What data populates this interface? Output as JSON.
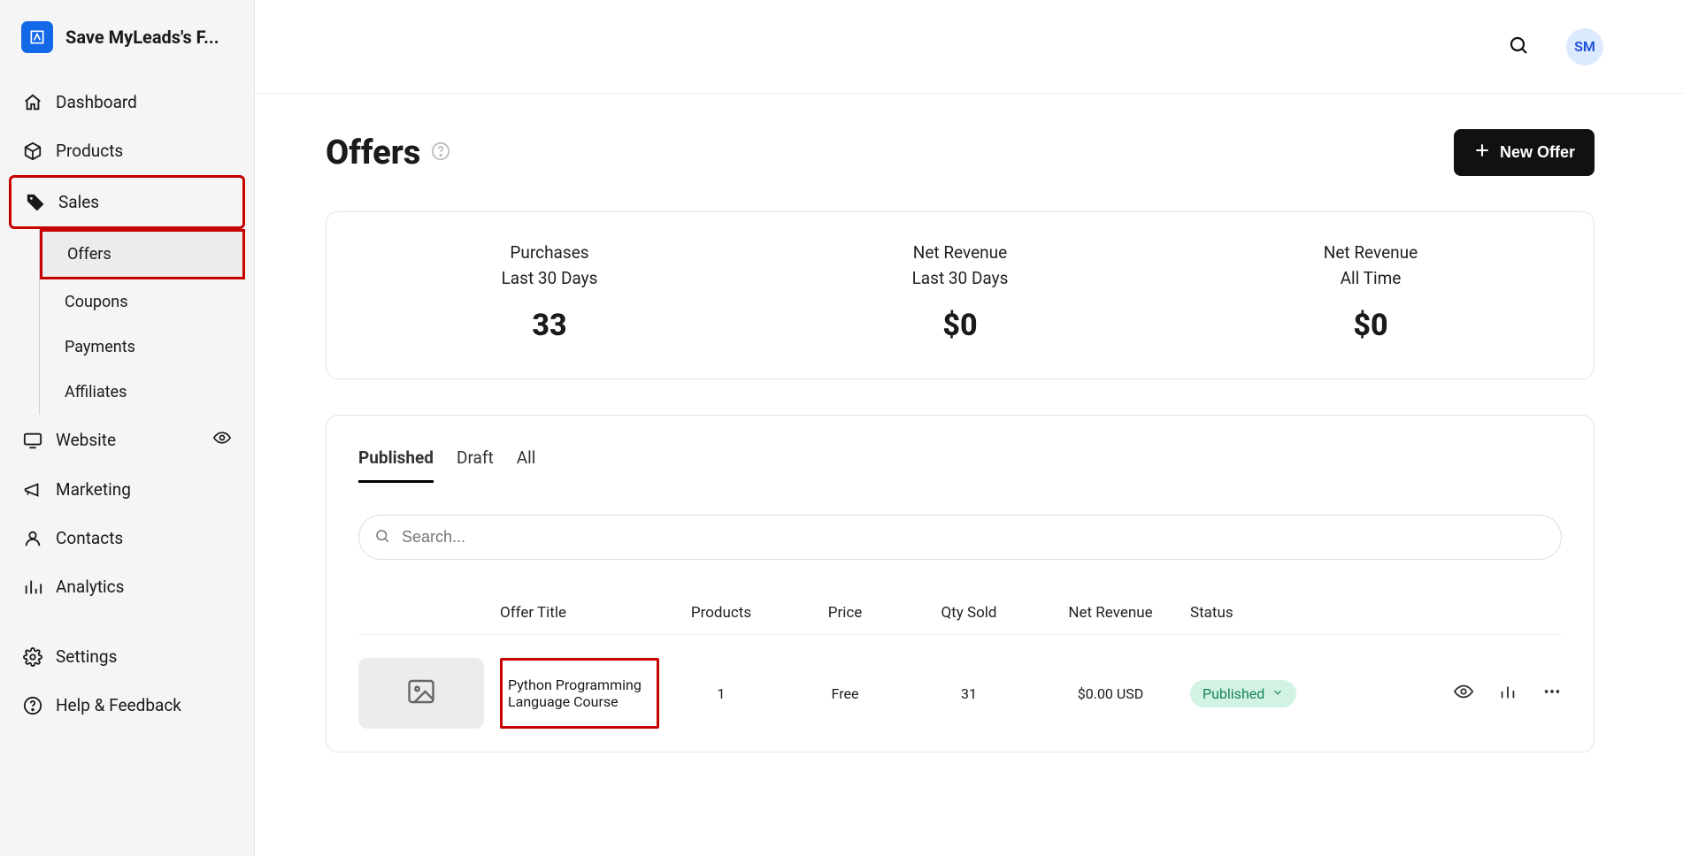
{
  "brand": {
    "title": "Save MyLeads's F...",
    "avatar_initials": "SM"
  },
  "nav": {
    "dashboard": "Dashboard",
    "products": "Products",
    "sales": "Sales",
    "website": "Website",
    "marketing": "Marketing",
    "contacts": "Contacts",
    "analytics": "Analytics",
    "settings": "Settings",
    "help": "Help & Feedback"
  },
  "subnav": {
    "offers": "Offers",
    "coupons": "Coupons",
    "payments": "Payments",
    "affiliates": "Affiliates"
  },
  "page": {
    "title": "Offers",
    "new_offer_label": "New Offer",
    "search_placeholder": "Search..."
  },
  "stats": [
    {
      "label": "Purchases",
      "sub": "Last 30 Days",
      "value": "33"
    },
    {
      "label": "Net Revenue",
      "sub": "Last 30 Days",
      "value": "$0"
    },
    {
      "label": "Net Revenue",
      "sub": "All Time",
      "value": "$0"
    }
  ],
  "tabs": {
    "published": "Published",
    "draft": "Draft",
    "all": "All"
  },
  "table": {
    "headers": {
      "title": "Offer Title",
      "products": "Products",
      "price": "Price",
      "qty": "Qty Sold",
      "net": "Net Revenue",
      "status": "Status"
    },
    "rows": [
      {
        "title": "Python Programming Language Course",
        "products": "1",
        "price": "Free",
        "qty": "31",
        "net": "$0.00 USD",
        "status": "Published"
      }
    ]
  }
}
